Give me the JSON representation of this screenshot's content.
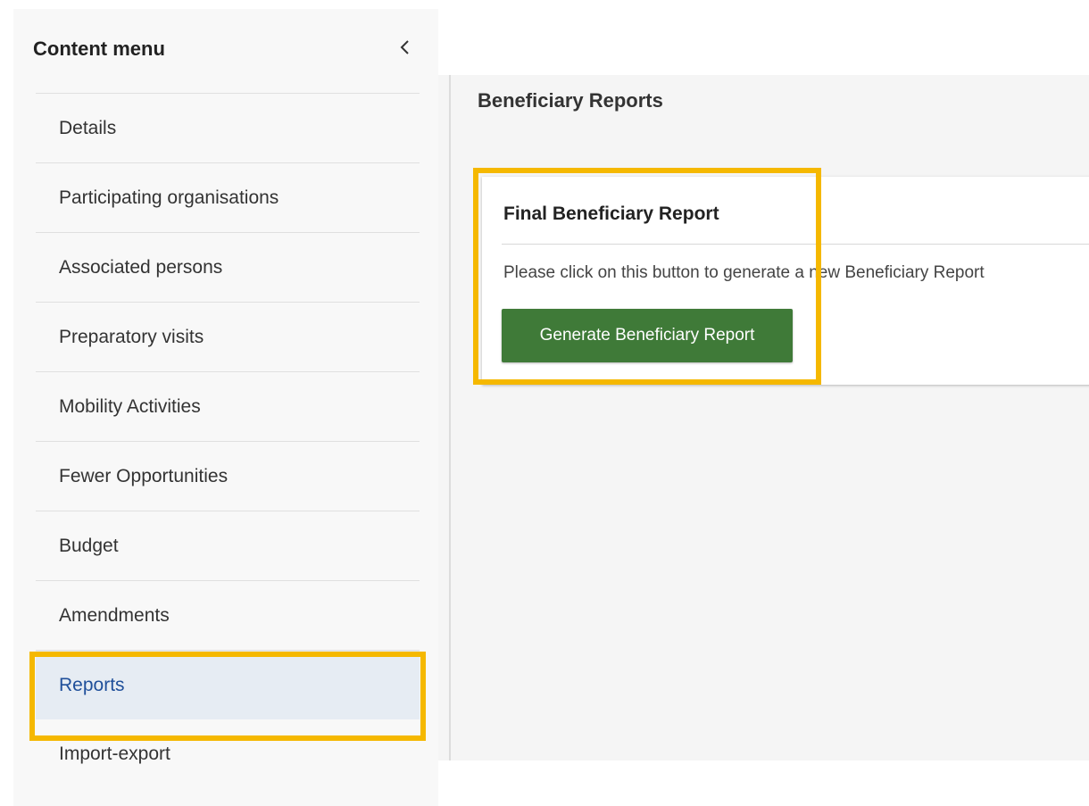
{
  "sidebar": {
    "title": "Content menu",
    "collapse_icon": "chevron-left-icon",
    "items": [
      {
        "label": "Details"
      },
      {
        "label": "Participating organisations"
      },
      {
        "label": "Associated persons"
      },
      {
        "label": "Preparatory visits"
      },
      {
        "label": "Mobility Activities"
      },
      {
        "label": "Fewer Opportunities"
      },
      {
        "label": "Budget"
      },
      {
        "label": "Amendments"
      },
      {
        "label": "Reports",
        "active": true
      },
      {
        "label": "Import-export"
      }
    ]
  },
  "main": {
    "title": "Beneficiary Reports",
    "card": {
      "title": "Final Beneficiary Report",
      "description": "Please click on this button to generate a new Beneficiary Report",
      "button_label": "Generate Beneficiary Report"
    }
  },
  "colors": {
    "highlight": "#f5b800",
    "button_bg": "#3f7a38",
    "active_item_bg": "#e6ecf3",
    "active_item_text": "#1f4f9a"
  }
}
